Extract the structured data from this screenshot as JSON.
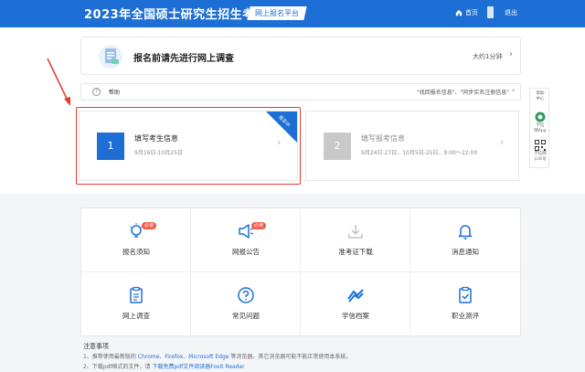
{
  "header": {
    "title": "2023年全国硕士研究生招生考试",
    "platform_tag": "网上报名平台",
    "home": "首页",
    "logout": "退出",
    "accent": "#1d6fd6"
  },
  "survey": {
    "title": "报名前请先进行网上调查",
    "time": "大约1分钟",
    "icon": "survey-document-icon"
  },
  "notice": {
    "label": "帮助",
    "text": "\"找回报名信息\"、\"同步实名注册信息\""
  },
  "steps": [
    {
      "number": "1",
      "title": "填写考生信息",
      "dates": "9月16日-10月25日",
      "ribbon": "报名中"
    },
    {
      "number": "2",
      "title": "填写报考信息",
      "dates": "9月24日-27日、10月5日-25日，9:00～22:00"
    }
  ],
  "side": {
    "help": [
      "帮助",
      "中心"
    ],
    "app": [
      "学信",
      "网App"
    ],
    "wechat": [
      "学信网",
      "公众号"
    ]
  },
  "menu": [
    {
      "label": "报名须知",
      "badge": "必读",
      "icon": "lightbulb-icon"
    },
    {
      "label": "网报公告",
      "badge": "必读",
      "icon": "megaphone-icon"
    },
    {
      "label": "准考证下载",
      "icon": "download-icon"
    },
    {
      "label": "消息通知",
      "icon": "bell-icon"
    },
    {
      "label": "网上调查",
      "icon": "clipboard-icon"
    },
    {
      "label": "常见问题",
      "icon": "question-icon"
    },
    {
      "label": "学信档案",
      "icon": "archive-icon"
    },
    {
      "label": "职业测评",
      "icon": "assessment-icon"
    }
  ],
  "notes": {
    "title": "注意事项",
    "line1_prefix": "1、推荐使用最新版的",
    "line1_browsers": "Chrome、Firefox、Microsoft Edge",
    "line1_suffix": "等浏览器，其它浏览器可能不能正常使用本系统。",
    "line2_prefix": "2、下载pdf格式的文件，请",
    "line2_link": "下载免费pdf文件阅读器Foxit Reader"
  }
}
